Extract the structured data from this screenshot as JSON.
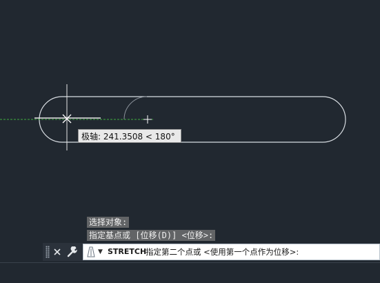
{
  "drawing": {
    "polar_tooltip": "极轴: 241.3508 < 180°"
  },
  "command_history": [
    "选择对象:",
    "指定基点或 [位移(D)] <位移>:"
  ],
  "command_line": {
    "command_name": "STRETCH",
    "prompt": "指定第二个点或 <使用第一个点作为位移>:"
  },
  "icons": {
    "grip": "grip-handle-icon",
    "close": "close-icon",
    "settings": "wrench-icon",
    "prompt": "command-prompt-icon",
    "dropdown": "chevron-down-icon"
  },
  "colors": {
    "background": "#212830",
    "geometry": "#d8dde2",
    "tracking_line": "#3fae3f",
    "ghost_geometry": "#8a9199"
  }
}
